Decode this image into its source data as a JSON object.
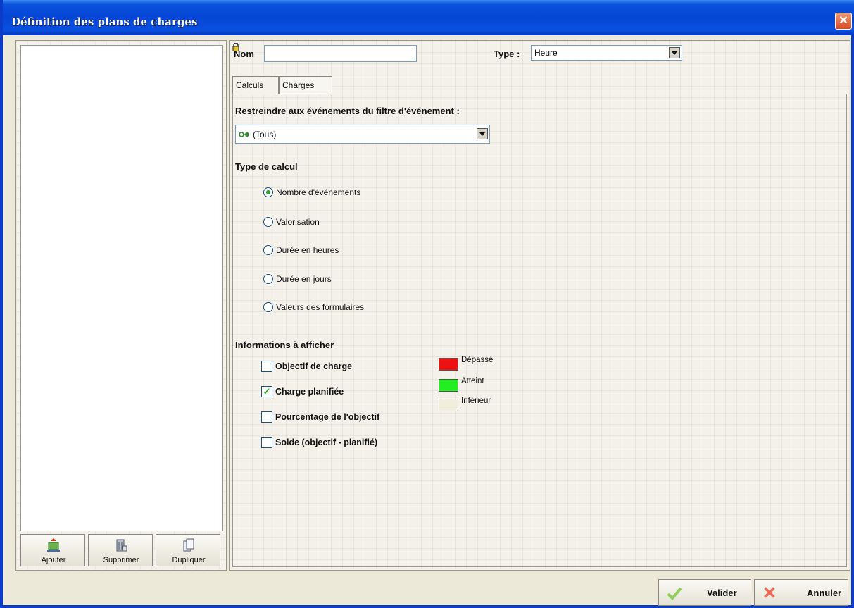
{
  "window": {
    "title": "Définition des plans de charges"
  },
  "left_toolbar": {
    "add_label": "Ajouter",
    "delete_label": "Supprimer",
    "duplicate_label": "Dupliquer"
  },
  "form": {
    "name_label": "Nom",
    "name_value": "",
    "type_label": "Type :",
    "type_value": "Heure"
  },
  "tabs": [
    {
      "label": "Calculs",
      "active": true
    },
    {
      "label": "Charges",
      "active": false
    }
  ],
  "calculs": {
    "filter_label": "Restreindre aux événements du filtre d'événement :",
    "filter_value": "(Tous)",
    "calc_type_label": "Type de calcul",
    "calc_options": [
      {
        "label": "Nombre d'événements",
        "selected": true
      },
      {
        "label": "Valorisation",
        "selected": false
      },
      {
        "label": "Durée en heures",
        "selected": false
      },
      {
        "label": "Durée en jours",
        "selected": false
      },
      {
        "label": "Valeurs des formulaires",
        "selected": false
      }
    ],
    "info_label": "Informations à afficher",
    "info_options": [
      {
        "label": "Objectif de charge",
        "checked": false
      },
      {
        "label": "Charge planifiée",
        "checked": true
      },
      {
        "label": "Pourcentage de l'objectif",
        "checked": false
      },
      {
        "label": "Solde (objectif - planifié)",
        "checked": false
      }
    ],
    "legend": [
      {
        "label": "Dépassé",
        "color": "#ee1111"
      },
      {
        "label": "Atteint",
        "color": "#22ee22"
      },
      {
        "label": "Inférieur",
        "color": "#f2eedc"
      }
    ]
  },
  "actions": {
    "validate_label": "Valider",
    "cancel_label": "Annuler"
  }
}
